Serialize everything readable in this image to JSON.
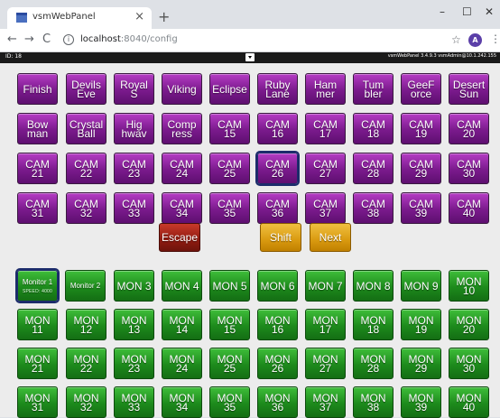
{
  "browser": {
    "tab_title": "vsmWebPanel",
    "tab_close": "×",
    "new_tab": "+",
    "win_min": "–",
    "win_max": "☐",
    "win_close": "✕",
    "nav_back": "←",
    "nav_forward": "→",
    "nav_reload": "C",
    "info": "i",
    "url_host": "localhost",
    "url_path": ":8040/config",
    "star": "☆",
    "avatar_letter": "A",
    "menu": "⋮"
  },
  "status": {
    "id": "ID: 18",
    "version": "vsmWebPanel 3.4.9.3 vsmAdmin@10.1.242.155"
  },
  "purple_rows": [
    [
      "Finish",
      "Devils\nEve",
      "Royal\nS",
      "Viking",
      "Eclipse",
      "Ruby\nLane",
      "Ham\nmer",
      "Tum\nbler",
      "GeeF\norce",
      "Desert\nSun"
    ],
    [
      "Bow\nman",
      "Crystal\nBall",
      "Hig\nhwav",
      "Comp\nress",
      "CAM\n15",
      "CAM\n16",
      "CAM\n17",
      "CAM\n18",
      "CAM\n19",
      "CAM\n20"
    ],
    [
      "CAM\n21",
      "CAM\n22",
      "CAM\n23",
      "CAM\n24",
      "CAM\n25",
      "CAM\n26",
      "CAM\n27",
      "CAM\n28",
      "CAM\n29",
      "CAM\n30"
    ],
    [
      "CAM\n31",
      "CAM\n32",
      "CAM\n33",
      "CAM\n34",
      "CAM\n35",
      "CAM\n36",
      "CAM\n37",
      "CAM\n38",
      "CAM\n39",
      "CAM\n40"
    ]
  ],
  "controls": {
    "escape": "Escape",
    "shift": "Shift",
    "next": "Next"
  },
  "green_row1": {
    "monitor1": "Monitor 1",
    "monitor1_sub": "SPEED: 4000",
    "monitor2": "Monitor 2",
    "others": [
      "MON 3",
      "MON 4",
      "MON 5",
      "MON 6",
      "MON 7",
      "MON 8",
      "MON 9",
      "MON\n10"
    ]
  },
  "green_rows": [
    [
      "MON\n11",
      "MON\n12",
      "MON\n13",
      "MON\n14",
      "MON\n15",
      "MON\n16",
      "MON\n17",
      "MON\n18",
      "MON\n19",
      "MON\n20"
    ],
    [
      "MON\n21",
      "MON\n22",
      "MON\n23",
      "MON\n24",
      "MON\n25",
      "MON\n26",
      "MON\n27",
      "MON\n28",
      "MON\n29",
      "MON\n30"
    ],
    [
      "MON\n31",
      "MON\n32",
      "MON\n33",
      "MON\n34",
      "MON\n35",
      "MON\n36",
      "MON\n37",
      "MON\n38",
      "MON\n39",
      "MON\n40"
    ]
  ],
  "colors": {
    "purple": "#7a1a8c",
    "green": "#1d8a1c",
    "escape_red": "#8f1a10",
    "amber": "#d99a10",
    "selected_outline": "#1c2c6b"
  }
}
